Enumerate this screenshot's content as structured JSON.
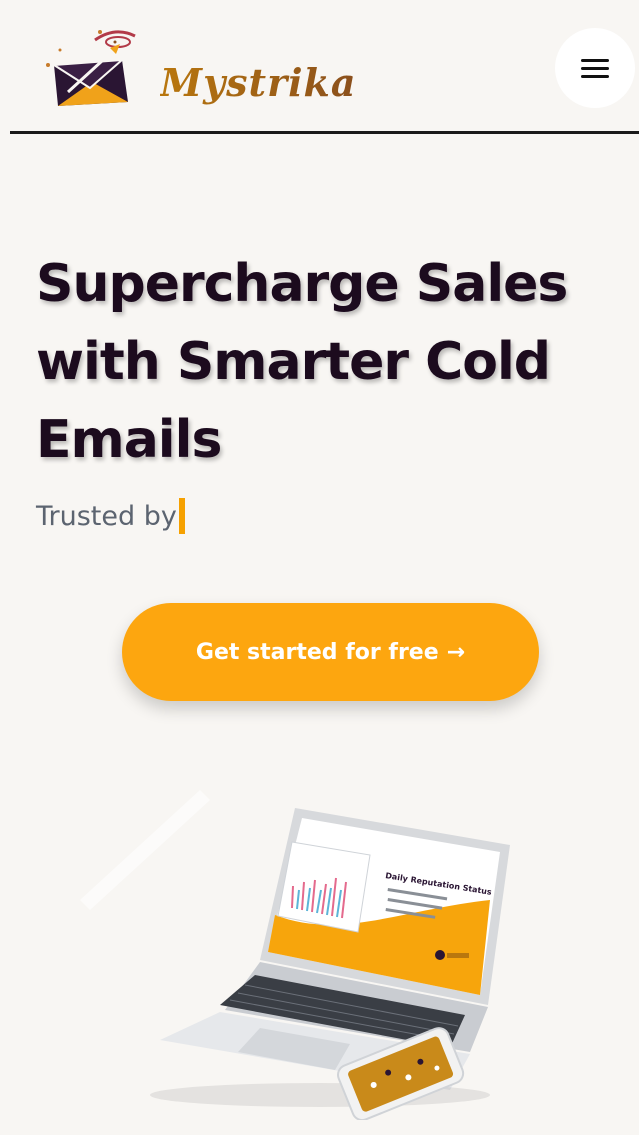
{
  "header": {
    "brand": "Mystrika",
    "menu_icon": "hamburger-icon"
  },
  "hero": {
    "title_line1": "Supercharge Sales",
    "title_line2": "with Smarter Cold",
    "title_line3": "Emails",
    "trusted_label": "Trusted by",
    "cta_label": "Get started for free",
    "cta_arrow": "→"
  },
  "mockup": {
    "screen_heading": "Daily Reputation Status"
  },
  "colors": {
    "accent": "#fda60f",
    "title": "#1c0b1e",
    "muted": "#5c6470",
    "background": "#f8f6f3"
  }
}
